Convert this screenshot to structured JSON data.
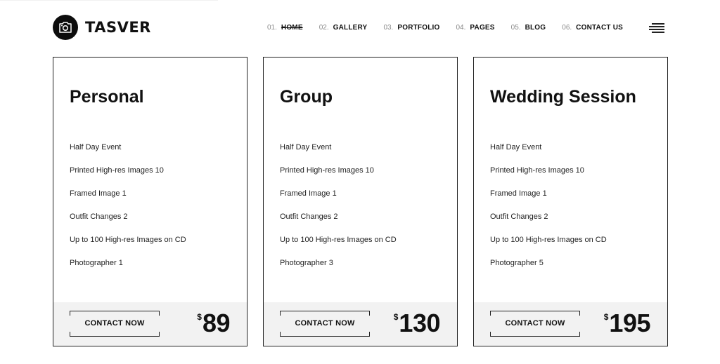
{
  "brand": {
    "name": "TASVER",
    "icon": "camera-icon"
  },
  "nav": [
    {
      "num": "01.",
      "label": "HOME",
      "active": true
    },
    {
      "num": "02.",
      "label": "GALLERY"
    },
    {
      "num": "03.",
      "label": "PORTFOLIO"
    },
    {
      "num": "04.",
      "label": "PAGES"
    },
    {
      "num": "05.",
      "label": "BLOG"
    },
    {
      "num": "06.",
      "label": "CONTACT US"
    }
  ],
  "menu_icon": "hamburger-icon",
  "plans": [
    {
      "title": "Personal",
      "features": [
        "Half Day Event",
        "Printed High-res Images 10",
        "Framed Image 1",
        "Outfit Changes 2",
        "Up to 100 High-res Images on CD",
        "Photographer 1"
      ],
      "button": "CONTACT NOW",
      "currency": "$",
      "price": "89"
    },
    {
      "title": "Group",
      "features": [
        "Half Day Event",
        "Printed High-res Images 10",
        "Framed Image 1",
        "Outfit Changes 2",
        "Up to 100 High-res Images on CD",
        "Photographer 3"
      ],
      "button": "CONTACT NOW",
      "currency": "$",
      "price": "130"
    },
    {
      "title": "Wedding Session",
      "features": [
        "Half Day Event",
        "Printed High-res Images 10",
        "Framed Image 1",
        "Outfit Changes 2",
        "Up to 100 High-res Images on CD",
        "Photographer 5"
      ],
      "button": "CONTACT NOW",
      "currency": "$",
      "price": "195"
    }
  ],
  "colors": {
    "text": "#111111",
    "footer_bg": "#f2f2f2",
    "border": "#222222",
    "nav_num": "#8a8a8a"
  }
}
